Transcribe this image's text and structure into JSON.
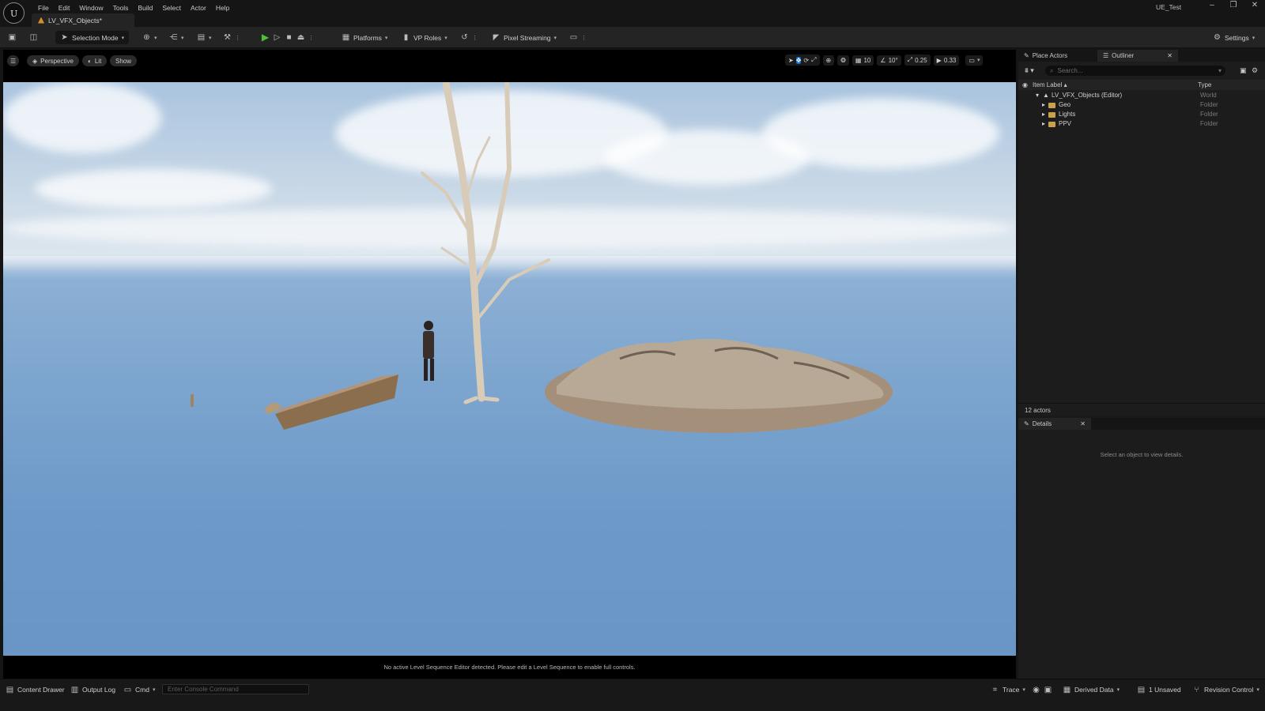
{
  "app": {
    "project_name": "UE_Test",
    "level_tab": "LV_VFX_Objects*",
    "menu": [
      "File",
      "Edit",
      "Window",
      "Tools",
      "Build",
      "Select",
      "Actor",
      "Help"
    ],
    "window_controls": [
      "–",
      "❐",
      "✕"
    ]
  },
  "toolbar": {
    "selection_mode": "Selection Mode",
    "platforms": "Platforms",
    "vp_roles": "VP Roles",
    "pixel_streaming": "Pixel Streaming",
    "settings": "Settings"
  },
  "viewport": {
    "perspective": "Perspective",
    "lit": "Lit",
    "show": "Show",
    "grid_snap": "10",
    "rotation_snap": "10°",
    "scale_snap": "0.25",
    "camera_speed": "0.33",
    "status_message": "No active Level Sequence Editor detected. Please edit a Level Sequence to enable full controls."
  },
  "panels": {
    "place_actors": "Place Actors",
    "outliner": "Outliner",
    "details": "Details",
    "search_placeholder": "Search...",
    "col_item_label": "Item Label ▴",
    "col_type": "Type",
    "tree": [
      {
        "label": "LV_VFX_Objects (Editor)",
        "type": "World",
        "depth": 0
      },
      {
        "label": "Geo",
        "type": "Folder",
        "depth": 1
      },
      {
        "label": "Lights",
        "type": "Folder",
        "depth": 1
      },
      {
        "label": "PPV",
        "type": "Folder",
        "depth": 1
      }
    ],
    "actor_count": "12 actors",
    "details_empty": "Select an object to view details."
  },
  "bottom": {
    "content_drawer": "Content Drawer",
    "output_log": "Output Log",
    "cmd": "Cmd",
    "console_placeholder": "Enter Console Command",
    "trace": "Trace",
    "derived_data": "Derived Data",
    "unsaved": "1 Unsaved",
    "revision_control": "Revision Control"
  }
}
